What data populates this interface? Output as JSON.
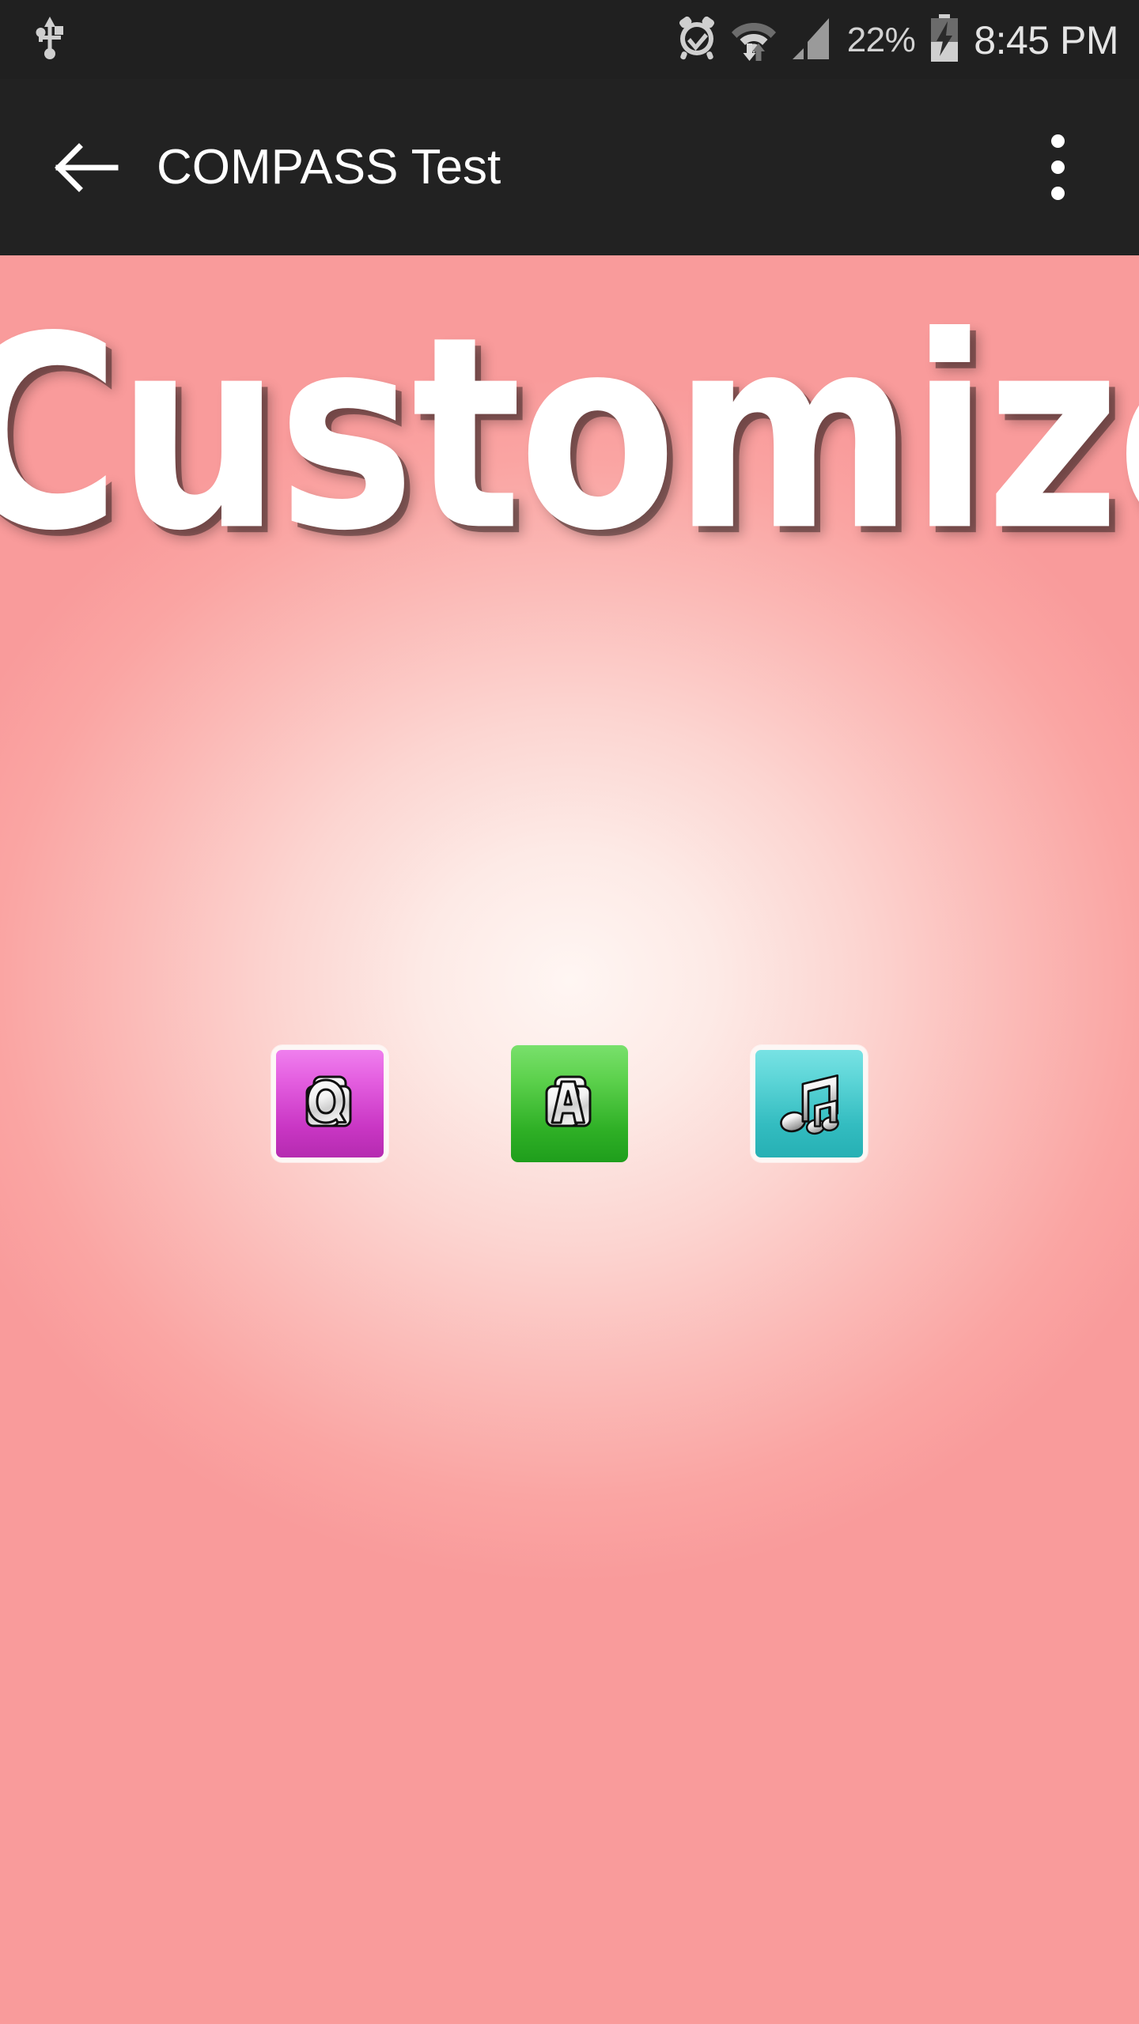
{
  "status_bar": {
    "left_icons": [
      {
        "name": "usb-icon",
        "label": "USB connected"
      }
    ],
    "right_icons": [
      {
        "name": "alarm-clock-icon",
        "label": "Alarm set"
      },
      {
        "name": "wifi-transfer-icon",
        "label": "Wi-Fi with data transfer"
      },
      {
        "name": "cellular-signal-icon",
        "label": "Cellular signal"
      },
      {
        "name": "battery-charging-icon",
        "label": "Battery charging"
      }
    ],
    "battery_percent": "22%",
    "clock": "8:45 PM",
    "background_color": "#202020",
    "text_color": "#d8d8d8"
  },
  "app_bar": {
    "back_label": "Navigate up",
    "title": "COMPASS Test",
    "overflow_label": "More options",
    "background_color": "#222222",
    "title_color": "#ffffff"
  },
  "screen": {
    "heading": "Customize",
    "heading_color": "#ffffff",
    "background_center_color": "#fff6f3",
    "background_edge_color": "#f99b9b"
  },
  "customize_options": [
    {
      "id": "question-cards",
      "name": "question-cards-button",
      "label": "Q",
      "icon": "stacked-cards-q-icon",
      "tile_class": "tile-q",
      "framed": true,
      "color_top": "#ef7fee",
      "color_bottom": "#b52bb0"
    },
    {
      "id": "answer-cards",
      "name": "answer-cards-button",
      "label": "A",
      "icon": "stacked-cards-a-icon",
      "tile_class": "tile-a",
      "framed": false,
      "color_top": "#79e06c",
      "color_bottom": "#1f9e1c"
    },
    {
      "id": "sounds",
      "name": "sounds-button",
      "label": "",
      "icon": "music-notes-icon",
      "tile_class": "tile-m",
      "framed": true,
      "color_top": "#78e2e4",
      "color_bottom": "#26b0b4"
    }
  ]
}
